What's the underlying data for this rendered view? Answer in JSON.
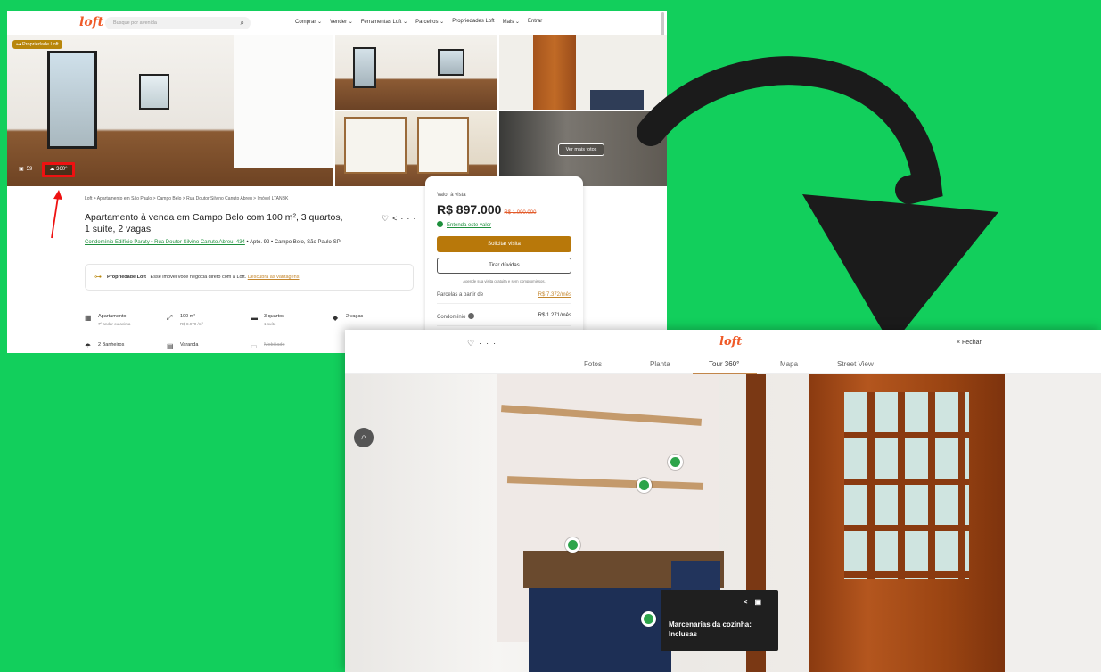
{
  "listing_page": {
    "search": {
      "placeholder": "Busque por avenida"
    },
    "nav": [
      "Comprar ⌄",
      "Vender ⌄",
      "Ferramentas Loft ⌄",
      "Parceiros ⌄",
      "Propriedades Loft",
      "Mais ⌄",
      "Entrar"
    ],
    "logo": "loft",
    "gallery": {
      "badge": "Propriedade Loft",
      "photo_count": "59",
      "tour_label": "360°",
      "more_photos": "Ver mais fotos"
    },
    "breadcrumb": "Loft  >  Apartamento em São Paulo  >  Campo Belo  >  Rua Doutor Silvino Canuto Abreu  >  Imóvel LTANBK",
    "title": "Apartamento à venda em Campo Belo com 100 m², 3 quartos, 1 suíte, 2 vagas",
    "address_link": "Condomínio Edifício Paraty • Rua Doutor Silvino Canuto Abreu, 434",
    "address_rest": " • Apto. 92 • Campo Belo, São Paulo-SP",
    "promo": {
      "bold": "Propriedade Loft",
      "text": "Esse imóvel você negocia direto com a Loft.",
      "link": "Descubra as vantagens"
    },
    "features": [
      {
        "label": "Apartamento",
        "sub": "7º andar ou acima"
      },
      {
        "label": "100 m²",
        "sub": "R$ 8.970 /m²"
      },
      {
        "label": "3 quartos",
        "sub": "1 suíte"
      },
      {
        "label": "2 vagas",
        "sub": ""
      },
      {
        "label": "2 Banheiros",
        "sub": ""
      },
      {
        "label": "Varanda",
        "sub": ""
      },
      {
        "label": "Mobiliado",
        "sub": ""
      }
    ],
    "price_card": {
      "label": "Valor à vista",
      "price": "R$ 897.000",
      "old_price": "R$ 1.090.000",
      "understand": "Entenda este valor",
      "cta_primary": "Solicitar visita",
      "cta_secondary": "Tirar dúvidas",
      "note": "Agende sua visita gratuita e sem compromissos.",
      "installments_label": "Parcelas a partir de",
      "installments_value": "R$ 7.372/mês",
      "condo_label": "Condomínio",
      "condo_value": "R$ 1.271/mês"
    }
  },
  "tour_page": {
    "logo": "loft",
    "close": "× Fechar",
    "tabs": [
      "Fotos",
      "Planta",
      "Tour 360°",
      "Mapa",
      "Street View"
    ],
    "active_tab": "Tour 360°",
    "tooltip": "Marcenarias da cozinha: Inclusas",
    "accent": "#c2864a"
  },
  "colors": {
    "background": "#12cf5c",
    "brand_orange": "#ef5a28",
    "cta_gold": "#b8780a",
    "hotspot_green": "#2ca44a"
  }
}
